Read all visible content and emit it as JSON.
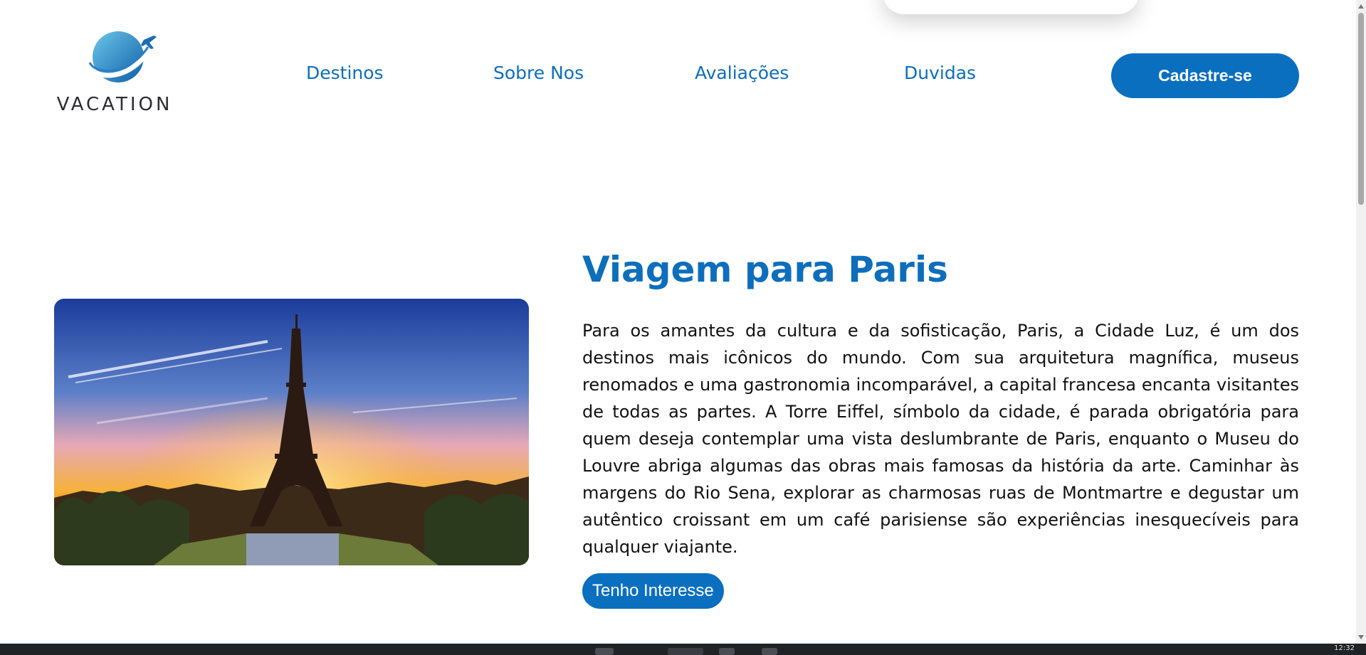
{
  "brand": {
    "name": "VACATION",
    "colors": {
      "accent": "#0A6FBF",
      "text": "#111111"
    }
  },
  "nav": {
    "items": [
      {
        "label": "Destinos"
      },
      {
        "label": "Sobre Nos"
      },
      {
        "label": "Avaliações"
      },
      {
        "label": "Duvidas"
      }
    ],
    "cta_label": "Cadastre-se"
  },
  "hero": {
    "image_name": "eiffel-tower-sunset-image",
    "title": "Viagem para Paris",
    "description": "Para os amantes da cultura e da sofisticação, Paris, a Cidade Luz, é um dos destinos mais icônicos do mundo. Com sua arquitetura magnífica, museus renomados e uma gastronomia incomparável, a capital francesa encanta visitantes de todas as partes. A Torre Eiffel, símbolo da cidade, é parada obrigatória para quem deseja contemplar uma vista deslumbrante de Paris, enquanto o Museu do Louvre abriga algumas das obras mais famosas da história da arte. Caminhar às margens do Rio Sena, explorar as charmosas ruas de Montmartre e degustar um autêntico croissant em um café parisiense são experiências inesquecíveis para qualquer viajante.",
    "button_label": "Tenho Interesse"
  },
  "taskbar": {
    "clock": "12:32"
  }
}
